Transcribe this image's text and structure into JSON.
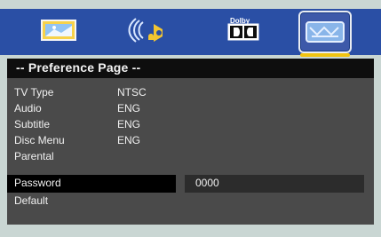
{
  "icons": [
    "general-setup-icon",
    "audio-setup-icon",
    "dolby-digital-icon",
    "preference-page-icon"
  ],
  "dolby_label": "Dolby",
  "title": "-- Preference Page --",
  "rows": [
    {
      "label": "TV Type",
      "value": "NTSC"
    },
    {
      "label": "Audio",
      "value": "ENG"
    },
    {
      "label": "Subtitle",
      "value": "ENG"
    },
    {
      "label": "Disc Menu",
      "value": "ENG"
    },
    {
      "label": "Parental",
      "value": ""
    }
  ],
  "password": {
    "label": "Password",
    "value": "0000"
  },
  "default_label": "Default",
  "colors": {
    "icon_bar": "#2a4fa5",
    "title_bar": "#0e0e0e",
    "panel": "#4a4a4a",
    "selection": "#f1c40f",
    "background": "#c9d6d3"
  }
}
